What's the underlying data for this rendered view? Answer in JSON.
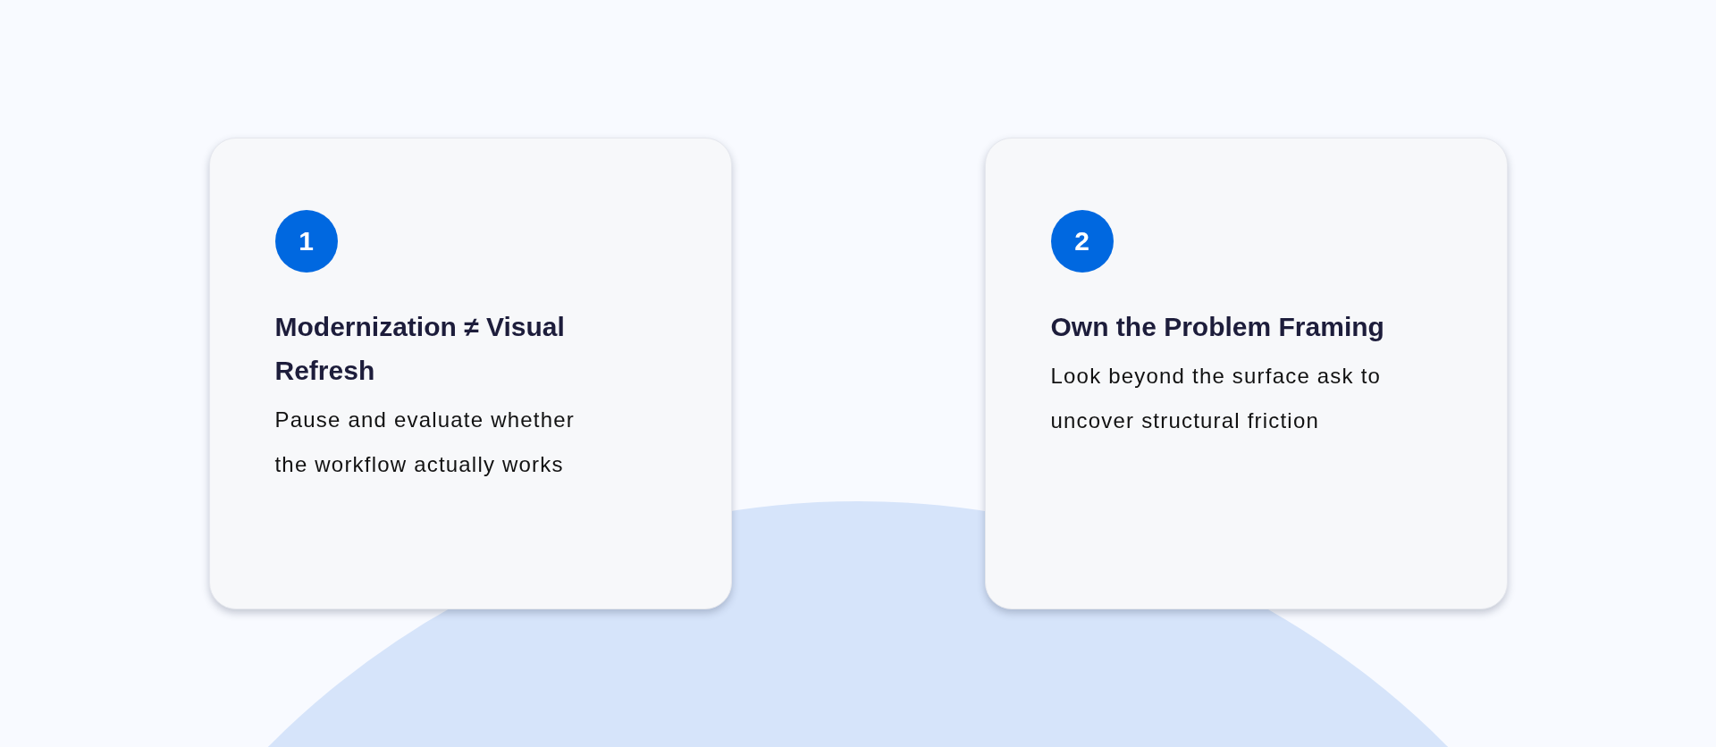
{
  "cards": [
    {
      "number": "1",
      "title": "Modernization ≠ Visual Refresh",
      "text": "Pause and evaluate whether the workflow actually works"
    },
    {
      "number": "2",
      "title": "Own the Problem Framing",
      "text": "Look beyond the surface ask to uncover structural friction"
    }
  ]
}
